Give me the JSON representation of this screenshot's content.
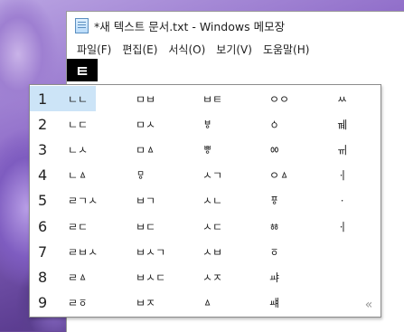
{
  "window": {
    "title": "*새 텍스트 문서.txt - Windows 메모장",
    "menu": [
      "파일(F)",
      "편집(E)",
      "서식(O)",
      "보기(V)",
      "도움말(H)"
    ],
    "composing_char": "ㅌ"
  },
  "candidates": {
    "selected_index": 0,
    "rows": [
      {
        "num": "1",
        "cells": [
          "ㄴㄴ",
          "ㅁㅂ",
          "ㅂㅌ",
          "ㅇㅇ",
          "ㅆ"
        ]
      },
      {
        "num": "2",
        "cells": [
          "ㄴㄷ",
          "ㅁㅅ",
          "ㅸ",
          "ㆁ",
          "ㆋ"
        ]
      },
      {
        "num": "3",
        "cells": [
          "ㄴㅅ",
          "ㅁㅿ",
          "ㅹ",
          "ㆀ",
          "ㆌ"
        ]
      },
      {
        "num": "4",
        "cells": [
          "ㄴㅿ",
          "ㅱ",
          "ㅅㄱ",
          "ㅇㅿ",
          "ㆎ"
        ]
      },
      {
        "num": "5",
        "cells": [
          "ㄹㄱㅅ",
          "ㅂㄱ",
          "ㅅㄴ",
          "ㆄ",
          "ㆍ"
        ]
      },
      {
        "num": "6",
        "cells": [
          "ㄹㄷ",
          "ㅂㄷ",
          "ㅅㄷ",
          "ㆅ",
          "ㆎ"
        ]
      },
      {
        "num": "7",
        "cells": [
          "ㄹㅂㅅ",
          "ㅂㅅㄱ",
          "ㅅㅂ",
          "ㆆ",
          ""
        ]
      },
      {
        "num": "8",
        "cells": [
          "ㄹㅿ",
          "ㅂㅅㄷ",
          "ㅅㅈ",
          "ㆇ",
          ""
        ]
      },
      {
        "num": "9",
        "cells": [
          "ㄹㆆ",
          "ㅂㅈ",
          "ㅿ",
          "ㆈ",
          ""
        ]
      }
    ],
    "more_button": "«"
  }
}
